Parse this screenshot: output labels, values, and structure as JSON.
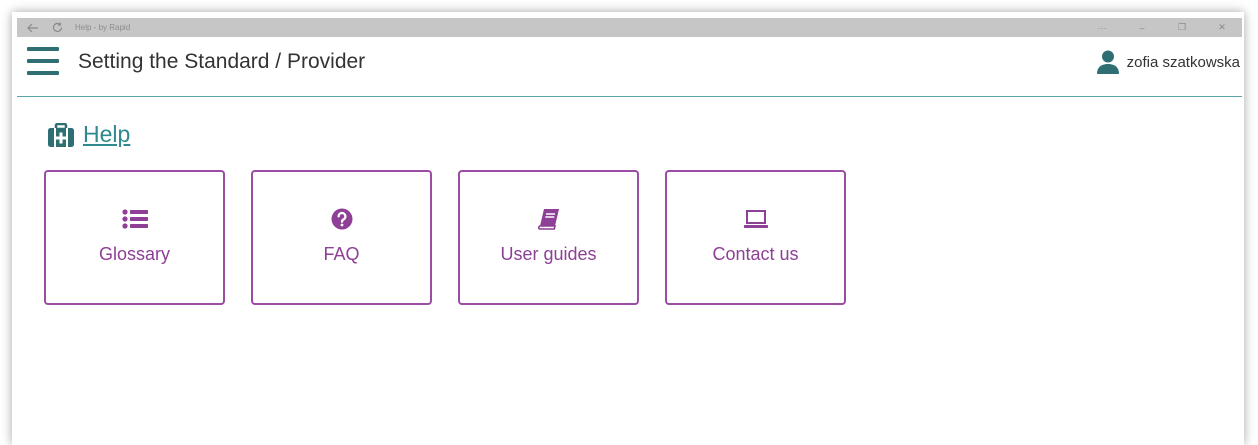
{
  "window": {
    "tab_title": "Help - by Rapid",
    "controls": {
      "more": "···",
      "minimize": "–",
      "maximize": "❐",
      "close": "✕"
    }
  },
  "header": {
    "breadcrumb": "Setting the Standard / Provider",
    "user_name": "zofia szatkowska"
  },
  "help": {
    "title": "Help"
  },
  "tiles": [
    {
      "label": "Glossary",
      "icon": "list-icon"
    },
    {
      "label": "FAQ",
      "icon": "question-circle-icon"
    },
    {
      "label": "User guides",
      "icon": "book-icon"
    },
    {
      "label": "Contact us",
      "icon": "laptop-icon"
    }
  ],
  "colors": {
    "accent_teal": "#2f6f73",
    "link_teal": "#2f8a8e",
    "tile_purple": "#9b4da3"
  }
}
